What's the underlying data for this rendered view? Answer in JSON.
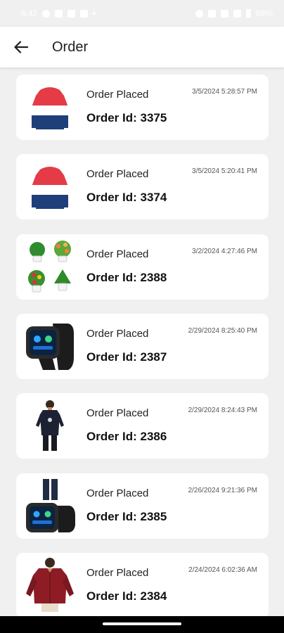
{
  "status_bar": {
    "time": "6:42",
    "battery": "89%"
  },
  "header": {
    "title": "Order"
  },
  "orders": [
    {
      "status": "Order Placed",
      "order_id": "Order Id: 3375",
      "date": "3/5/2024 5:28:57 PM",
      "product": "hoodie"
    },
    {
      "status": "Order Placed",
      "order_id": "Order Id: 3374",
      "date": "3/5/2024 5:20:41 PM",
      "product": "hoodie"
    },
    {
      "status": "Order Placed",
      "order_id": "Order Id: 2388",
      "date": "3/2/2024 4:27:46 PM",
      "product": "plants"
    },
    {
      "status": "Order Placed",
      "order_id": "Order Id: 2387",
      "date": "2/29/2024 8:25:40 PM",
      "product": "smartwatch"
    },
    {
      "status": "Order Placed",
      "order_id": "Order Id: 2386",
      "date": "2/29/2024 8:24:43 PM",
      "product": "tshirt"
    },
    {
      "status": "Order Placed",
      "order_id": "Order Id: 2385",
      "date": "2/26/2024 9:21:36 PM",
      "product": "watch-and-jeans"
    },
    {
      "status": "Order Placed",
      "order_id": "Order Id: 2384",
      "date": "2/24/2024 6:02:36 AM",
      "product": "shirt"
    }
  ],
  "colors": {
    "hoodie_red": "#e53b47",
    "hoodie_blue": "#1f3f7a",
    "card_bg": "#ffffff",
    "page_bg": "#f0f0f0"
  }
}
